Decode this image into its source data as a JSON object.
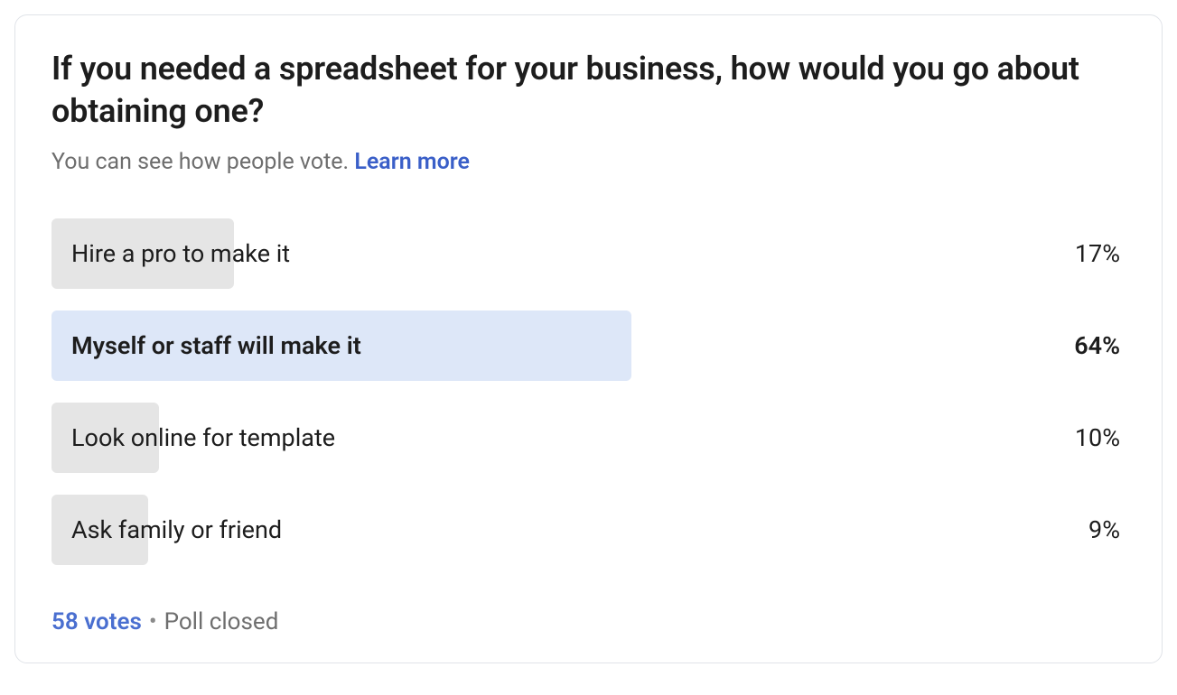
{
  "question": "If you needed a spreadsheet for your business, how would you go about obtaining one?",
  "subtitle_text": "You can see how people vote. ",
  "learn_more": "Learn more",
  "options": [
    {
      "label": "Hire a pro to make it",
      "pct": "17%",
      "width": "17%",
      "barClass": "grey",
      "bold": false
    },
    {
      "label": "Myself or staff will make it",
      "pct": "64%",
      "width": "54%",
      "barClass": "blue",
      "bold": true
    },
    {
      "label": "Look online for template",
      "pct": "10%",
      "width": "10%",
      "barClass": "grey",
      "bold": false
    },
    {
      "label": "Ask family or friend",
      "pct": "9%",
      "width": "9%",
      "barClass": "grey",
      "bold": false
    }
  ],
  "footer": {
    "votes": "58 votes",
    "dot": "•",
    "status": "Poll closed"
  },
  "chart_data": {
    "type": "bar",
    "title": "If you needed a spreadsheet for your business, how would you go about obtaining one?",
    "categories": [
      "Hire a pro to make it",
      "Myself or staff will make it",
      "Look online for template",
      "Ask family or friend"
    ],
    "values": [
      17,
      64,
      10,
      9
    ],
    "unit": "%",
    "n": 58,
    "xlabel": "",
    "ylabel": "",
    "ylim": [
      0,
      100
    ]
  }
}
